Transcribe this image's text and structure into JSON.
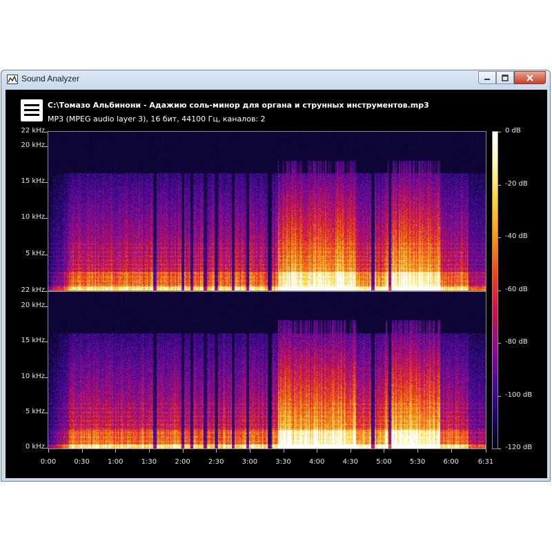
{
  "window": {
    "title": "Sound Analyzer",
    "icons": {
      "app": "sound-analyzer-icon",
      "minimize": "minimize-icon",
      "maximize": "maximize-icon",
      "close": "close-icon",
      "menu": "hamburger-menu-icon"
    }
  },
  "file": {
    "path": "C:\\Томазо Альбинони - Адажию соль-минор для органа и струнных инструментов.mp3",
    "info": "MP3 (MPEG audio layer 3), 16 бит, 44100 Гц, каналов: 2"
  },
  "spectrogram": {
    "channel_1_y_labels": [
      "22 kHz",
      "20 kHz",
      "15 kHz",
      "10 kHz",
      "5 kHz"
    ],
    "channel_2_y_labels": [
      "22 kHz",
      "20 kHz",
      "15 kHz",
      "10 kHz",
      "5 kHz",
      "0 kHz"
    ],
    "y_values_khz": [
      22,
      20,
      15,
      10,
      5,
      0
    ],
    "x_labels": [
      "0:00",
      "0:30",
      "1:00",
      "1:30",
      "2:00",
      "2:30",
      "3:00",
      "3:30",
      "4:00",
      "4:30",
      "5:00",
      "5:30",
      "6:00",
      "6:31"
    ],
    "x_values_seconds": [
      0,
      30,
      60,
      90,
      120,
      150,
      180,
      210,
      240,
      270,
      300,
      330,
      360,
      391
    ],
    "duration_seconds": 391,
    "colorbar_labels": [
      "0 dB",
      "-20 dB",
      "-40 dB",
      "-60 dB",
      "-80 dB",
      "-100 dB",
      "-120 dB"
    ],
    "colorbar_values_db": [
      0,
      -20,
      -40,
      -60,
      -80,
      -100,
      -120
    ],
    "palette": [
      "#ffffff",
      "#fff9b0",
      "#fcd23a",
      "#f8901c",
      "#ec4515",
      "#c81552",
      "#8e0d88",
      "#4a0a9a",
      "#1a0860",
      "#05030f"
    ]
  }
}
